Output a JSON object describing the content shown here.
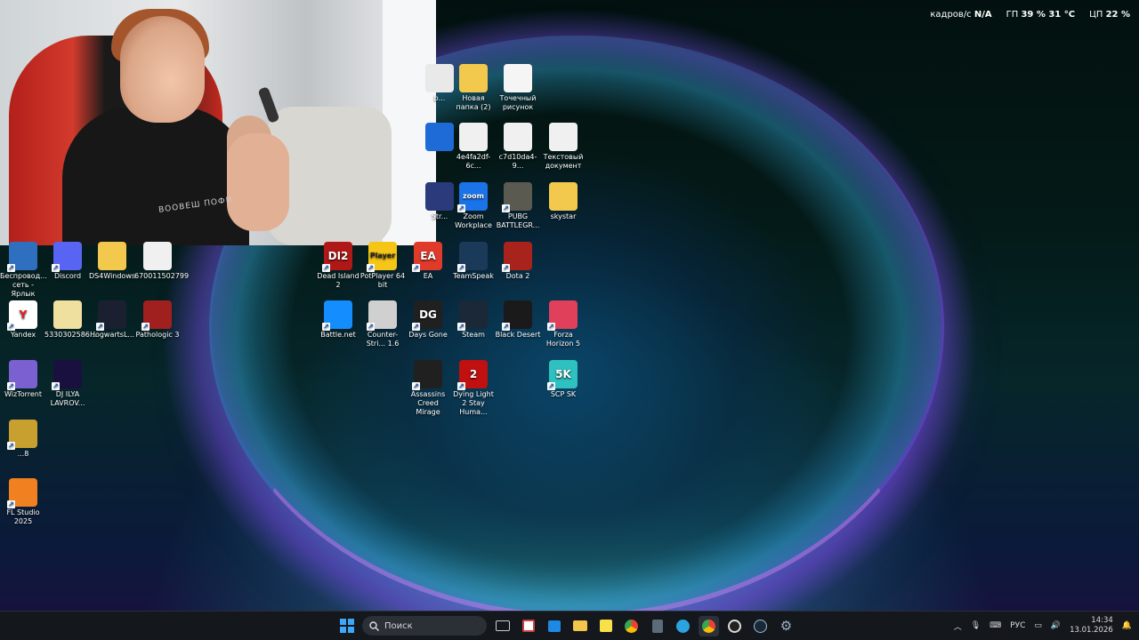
{
  "overlay": {
    "fps_label": "кадров/с",
    "fps_value": "N/A",
    "gpu_label": "ГП",
    "gpu_value": "39 % 31 °C",
    "cpu_label": "ЦП",
    "cpu_value": "22 %"
  },
  "webcam": {
    "shirt_text": "BOOBEШ ПОФИ"
  },
  "desktop_icons": [
    {
      "id": "partial-1",
      "label": "b...",
      "color": "#e9e9e9"
    },
    {
      "id": "new-folder",
      "label": "Новая папка (2)",
      "color": "#f2c94c"
    },
    {
      "id": "bitmap",
      "label": "Точечный рисунок",
      "color": "#f5f5f5"
    },
    {
      "id": "partial-2",
      "label": "",
      "color": "#1e6bd8"
    },
    {
      "id": "file-4e4f",
      "label": "4e4fa2df-6c...",
      "color": "#f0f0f0"
    },
    {
      "id": "file-c7d1",
      "label": "c7d10da4-9...",
      "color": "#f0f0f0"
    },
    {
      "id": "text-doc",
      "label": "Текстовый документ",
      "color": "#f0f0f0"
    },
    {
      "id": "partial-3",
      "label": "Str...",
      "color": "#2a3a7a"
    },
    {
      "id": "zoom",
      "label": "Zoom Workplace",
      "color": "#1a73e8",
      "glyph": "zoom"
    },
    {
      "id": "pubg",
      "label": "PUBG BATTLEGR...",
      "color": "#5a5a50"
    },
    {
      "id": "skystar",
      "label": "skystar",
      "color": "#f2c94c"
    },
    {
      "id": "wireless",
      "label": "Беспровод... сеть - Ярлык",
      "color": "#2f6fc0"
    },
    {
      "id": "discord",
      "label": "Discord",
      "color": "#5865f2"
    },
    {
      "id": "ds4windows",
      "label": "DS4Windows",
      "color": "#f2c94c"
    },
    {
      "id": "file-670",
      "label": "670011502799",
      "color": "#f0f0f0"
    },
    {
      "id": "dead-island",
      "label": "Dead Island 2",
      "color": "#b01818",
      "glyph": "DI2"
    },
    {
      "id": "potplayer",
      "label": "PotPlayer 64 bit",
      "color": "#f5c518",
      "glyph": "Player"
    },
    {
      "id": "ea",
      "label": "EA",
      "color": "#e03a2a",
      "glyph": "EA"
    },
    {
      "id": "teamspeak",
      "label": "TeamSpeak",
      "color": "#1b3a5a"
    },
    {
      "id": "dota2",
      "label": "Dota 2",
      "color": "#a8231b"
    },
    {
      "id": "yandex",
      "label": "Yandex",
      "color": "#ffffff",
      "glyph": "Y"
    },
    {
      "id": "file-533",
      "label": "5330302586...",
      "color": "#f0e0a0"
    },
    {
      "id": "hogwarts",
      "label": "HogwartsL...",
      "color": "#1a2030"
    },
    {
      "id": "pathologic",
      "label": "Pathologic 3",
      "color": "#a02020"
    },
    {
      "id": "battlenet",
      "label": "Battle.net",
      "color": "#148eff"
    },
    {
      "id": "cs16",
      "label": "Counter-Stri... 1.6",
      "color": "#d0d0d0"
    },
    {
      "id": "days-gone",
      "label": "Days Gone",
      "color": "#202020",
      "glyph": "DG"
    },
    {
      "id": "steam",
      "label": "Steam",
      "color": "#1b2838"
    },
    {
      "id": "black-desert",
      "label": "Black Desert",
      "color": "#1a1a1a"
    },
    {
      "id": "forza",
      "label": "Forza Horizon 5",
      "color": "#e0405a"
    },
    {
      "id": "wiztorrent",
      "label": "WizTorrent",
      "color": "#7a60d0"
    },
    {
      "id": "dj-ilya",
      "label": "DJ ILYA LAVROV...",
      "color": "#1a1040"
    },
    {
      "id": "assassins",
      "label": "Assassins Creed Mirage",
      "color": "#202020"
    },
    {
      "id": "dying-light",
      "label": "Dying Light 2 Stay Huma...",
      "color": "#c01010",
      "glyph": "2"
    },
    {
      "id": "scp",
      "label": "SCP SK",
      "color": "#2fc0c0",
      "glyph": "5K"
    },
    {
      "id": "partial-8",
      "label": "...8",
      "color": "#c8a030"
    },
    {
      "id": "fl-studio",
      "label": "FL Studio 2025",
      "color": "#f08020"
    }
  ],
  "taskbar": {
    "search_placeholder": "Поиск",
    "language": "РУС",
    "time": "14:34",
    "date": "13.01.2026"
  }
}
